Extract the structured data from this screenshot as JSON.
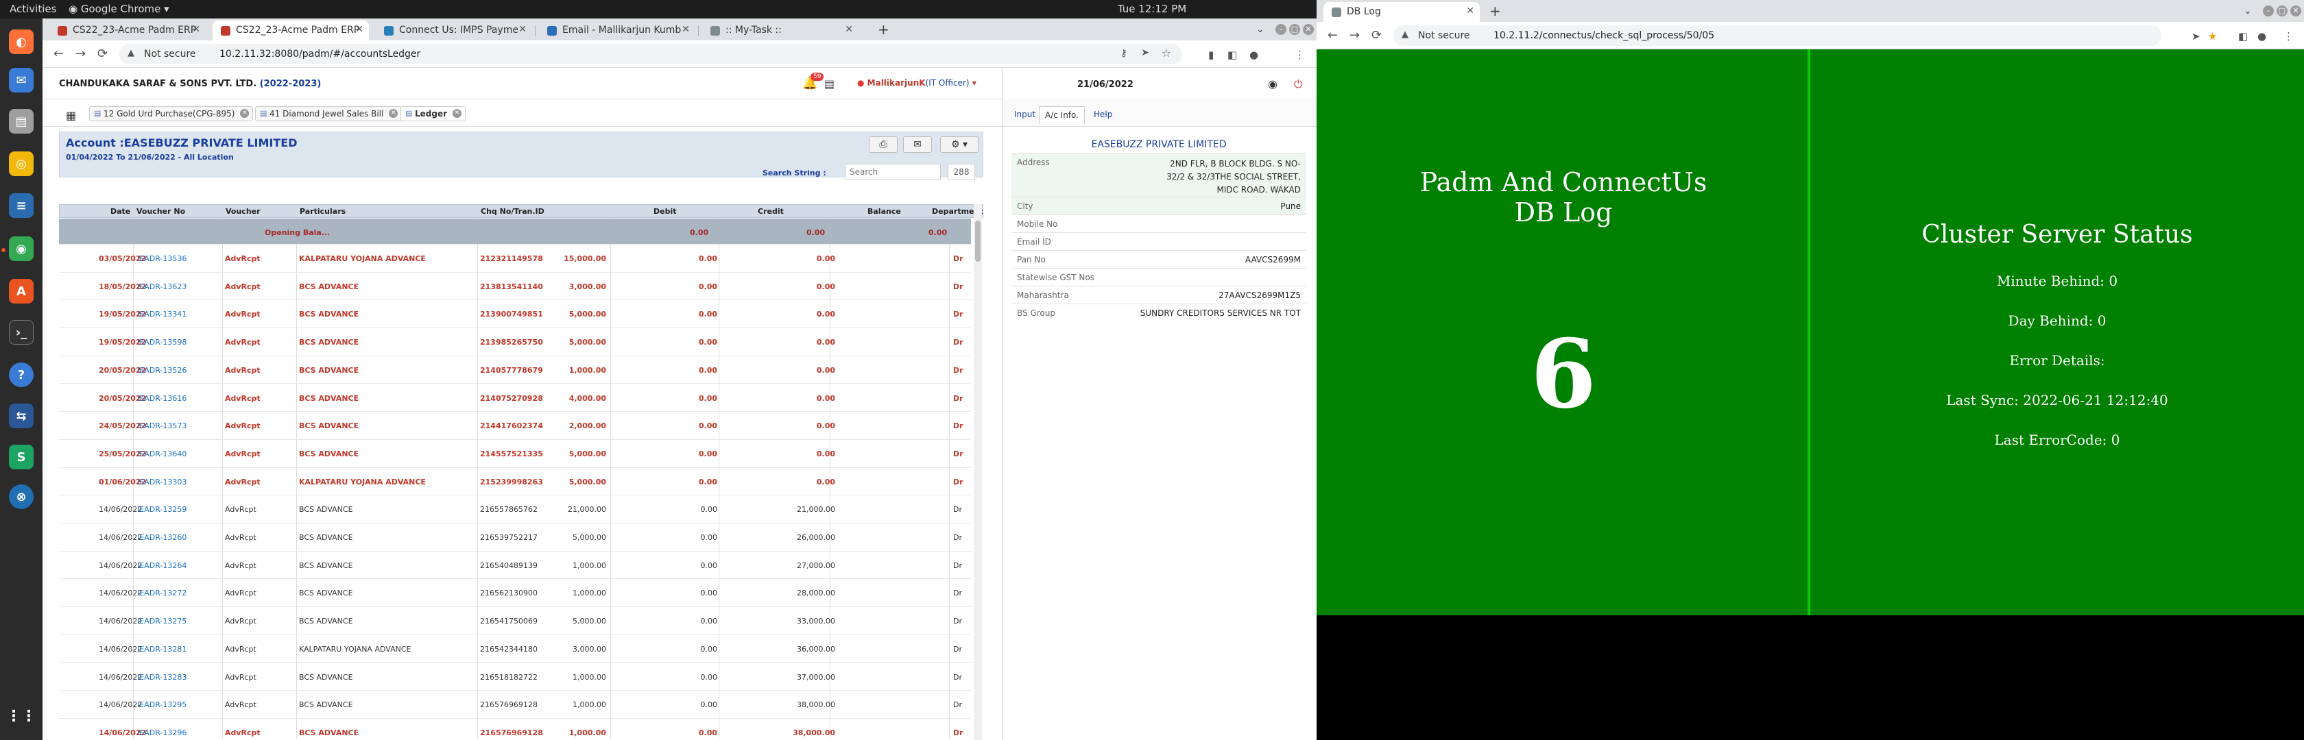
{
  "topbar": {
    "activities": "Activities",
    "app": "Google Chrome ▾",
    "clock": "Tue 12:12 PM"
  },
  "dock": {
    "icons": [
      "firefox-icon",
      "thunderbird-icon",
      "files-icon",
      "rhythmbox-icon",
      "writer-icon",
      "chrome-icon",
      "software-icon",
      "terminal-icon",
      "help-icon",
      "remmina-icon",
      "sheets-icon",
      "network-icon",
      "app-grid-icon"
    ]
  },
  "win1": {
    "tabs": [
      {
        "label": "CS22_23-Acme Padm ERP",
        "color": "#c0392b"
      },
      {
        "label": "CS22_23-Acme Padm ERP",
        "color": "#c0392b"
      },
      {
        "label": "Connect Us: IMPS Payme",
        "color": "#2980b9"
      },
      {
        "label": "Email - Mallikarjun Kumb",
        "color": "#2c6fbb"
      },
      {
        "label": ":: My-Task ::",
        "color": "#7f8c8d"
      }
    ],
    "url": "10.2.11.32:8080/padm/#/accountsLedger",
    "not_secure": "Not secure"
  },
  "app": {
    "company": "CHANDUKAKA SARAF & SONS PVT. LTD.",
    "year": "(2022-2023)",
    "badge": "59",
    "user": "MallikarjunK",
    "role": "(IT Officer)",
    "date": "21/06/2022",
    "page_tabs": [
      "12 Gold Urd Purchase(CPG-895)",
      "41 Diamond Jewel Sales Bill",
      "Ledger"
    ],
    "account": "Account :EASEBUZZ PRIVATE LIMITED",
    "period": "01/04/2022 To 21/06/2022 - All Location",
    "search_label": "Search String :",
    "search_placeholder": "Search",
    "search_count": "288",
    "columns": [
      "Date",
      "Voucher No",
      "Voucher",
      "Particulars",
      "Chq No/Tran.ID",
      "Debit",
      "Credit",
      "Balance",
      "Department"
    ],
    "opening": {
      "voucher": "Opening Bala...",
      "debit": "0.00",
      "credit": "0.00",
      "balance": "0.00"
    },
    "rows": [
      {
        "date": "03/05/2022",
        "vno": "IEADR-13536",
        "voucher": "AdvRcpt",
        "part": "KALPATARU YOJANA ADVANCE",
        "chq": "212321149578",
        "debit": "15,000.00",
        "credit": "0.00",
        "bal": "0.00",
        "drcr": "Dr",
        "red": true
      },
      {
        "date": "18/05/2022",
        "vno": "IEADR-13623",
        "voucher": "AdvRcpt",
        "part": "BCS ADVANCE",
        "chq": "213813541140",
        "debit": "3,000.00",
        "credit": "0.00",
        "bal": "0.00",
        "drcr": "Dr",
        "red": true
      },
      {
        "date": "19/05/2022",
        "vno": "IEADR-13341",
        "voucher": "AdvRcpt",
        "part": "BCS ADVANCE",
        "chq": "213900749851",
        "debit": "5,000.00",
        "credit": "0.00",
        "bal": "0.00",
        "drcr": "Dr",
        "red": true
      },
      {
        "date": "19/05/2022",
        "vno": "IEADR-13598",
        "voucher": "AdvRcpt",
        "part": "BCS ADVANCE",
        "chq": "213985265750",
        "debit": "5,000.00",
        "credit": "0.00",
        "bal": "0.00",
        "drcr": "Dr",
        "red": true
      },
      {
        "date": "20/05/2022",
        "vno": "IEADR-13526",
        "voucher": "AdvRcpt",
        "part": "BCS ADVANCE",
        "chq": "214057778679",
        "debit": "1,000.00",
        "credit": "0.00",
        "bal": "0.00",
        "drcr": "Dr",
        "red": true
      },
      {
        "date": "20/05/2022",
        "vno": "IEADR-13616",
        "voucher": "AdvRcpt",
        "part": "BCS ADVANCE",
        "chq": "214075270928",
        "debit": "4,000.00",
        "credit": "0.00",
        "bal": "0.00",
        "drcr": "Dr",
        "red": true
      },
      {
        "date": "24/05/2022",
        "vno": "IEADR-13573",
        "voucher": "AdvRcpt",
        "part": "BCS ADVANCE",
        "chq": "214417602374",
        "debit": "2,000.00",
        "credit": "0.00",
        "bal": "0.00",
        "drcr": "Dr",
        "red": true
      },
      {
        "date": "25/05/2022",
        "vno": "IEADR-13640",
        "voucher": "AdvRcpt",
        "part": "BCS ADVANCE",
        "chq": "214557521335",
        "debit": "5,000.00",
        "credit": "0.00",
        "bal": "0.00",
        "drcr": "Dr",
        "red": true
      },
      {
        "date": "01/06/2022",
        "vno": "IEADR-13303",
        "voucher": "AdvRcpt",
        "part": "KALPATARU YOJANA ADVANCE",
        "chq": "215239998263",
        "debit": "5,000.00",
        "credit": "0.00",
        "bal": "0.00",
        "drcr": "Dr",
        "red": true
      },
      {
        "date": "14/06/2022",
        "vno": "IEADR-13259",
        "voucher": "AdvRcpt",
        "part": "BCS ADVANCE",
        "chq": "216557865762",
        "debit": "21,000.00",
        "credit": "0.00",
        "bal": "21,000.00",
        "drcr": "Dr",
        "red": false
      },
      {
        "date": "14/06/2022",
        "vno": "IEADR-13260",
        "voucher": "AdvRcpt",
        "part": "BCS ADVANCE",
        "chq": "216539752217",
        "debit": "5,000.00",
        "credit": "0.00",
        "bal": "26,000.00",
        "drcr": "Dr",
        "red": false
      },
      {
        "date": "14/06/2022",
        "vno": "IEADR-13264",
        "voucher": "AdvRcpt",
        "part": "BCS ADVANCE",
        "chq": "216540489139",
        "debit": "1,000.00",
        "credit": "0.00",
        "bal": "27,000.00",
        "drcr": "Dr",
        "red": false
      },
      {
        "date": "14/06/2022",
        "vno": "IEADR-13272",
        "voucher": "AdvRcpt",
        "part": "BCS ADVANCE",
        "chq": "216562130900",
        "debit": "1,000.00",
        "credit": "0.00",
        "bal": "28,000.00",
        "drcr": "Dr",
        "red": false
      },
      {
        "date": "14/06/2022",
        "vno": "IEADR-13275",
        "voucher": "AdvRcpt",
        "part": "BCS ADVANCE",
        "chq": "216541750069",
        "debit": "5,000.00",
        "credit": "0.00",
        "bal": "33,000.00",
        "drcr": "Dr",
        "red": false
      },
      {
        "date": "14/06/2022",
        "vno": "IEADR-13281",
        "voucher": "AdvRcpt",
        "part": "KALPATARU YOJANA ADVANCE",
        "chq": "216542344180",
        "debit": "3,000.00",
        "credit": "0.00",
        "bal": "36,000.00",
        "drcr": "Dr",
        "red": false
      },
      {
        "date": "14/06/2022",
        "vno": "IEADR-13283",
        "voucher": "AdvRcpt",
        "part": "BCS ADVANCE",
        "chq": "216518182722",
        "debit": "1,000.00",
        "credit": "0.00",
        "bal": "37,000.00",
        "drcr": "Dr",
        "red": false
      },
      {
        "date": "14/06/2022",
        "vno": "IEADR-13295",
        "voucher": "AdvRcpt",
        "part": "BCS ADVANCE",
        "chq": "216576969128",
        "debit": "1,000.00",
        "credit": "0.00",
        "bal": "38,000.00",
        "drcr": "Dr",
        "red": false
      },
      {
        "date": "14/06/2022",
        "vno": "IEADR-13296",
        "voucher": "AdvRcpt",
        "part": "BCS ADVANCE",
        "chq": "216576969128",
        "debit": "1,000.00",
        "credit": "0.00",
        "bal": "38,000.00",
        "drcr": "Dr",
        "red": true
      }
    ],
    "right_tabs": [
      "Input",
      "A/c Info.",
      "Help"
    ],
    "info_name": "EASEBUZZ PRIVATE LIMITED",
    "info": [
      {
        "k": "Address",
        "v": "2ND FLR, B BLOCK BLDG. S NO- 32/2 & 32/3THE SOCIAL STREET, MIDC ROAD. WAKAD"
      },
      {
        "k": "City",
        "v": "Pune"
      },
      {
        "k": "Mobile No",
        "v": ""
      },
      {
        "k": "Email ID",
        "v": ""
      },
      {
        "k": "Pan No",
        "v": "AAVCS2699M"
      },
      {
        "k": "Statewise GST Nos",
        "v": ""
      },
      {
        "k": "Maharashtra",
        "v": "27AAVCS2699M1Z5"
      },
      {
        "k": "BS Group",
        "v": "SUNDRY CREDITORS SERVICES NR TOT"
      }
    ]
  },
  "win2": {
    "tab": "DB Log",
    "url": "10.2.11.2/connectus/check_sql_process/50/05",
    "not_secure": "Not secure",
    "left_title_1": "Padm And ConnectUs",
    "left_title_2": "DB Log",
    "number": "6",
    "right_title": "Cluster Server Status",
    "lines": [
      "Minute Behind: 0",
      "Day Behind: 0",
      "Error Details:",
      "Last Sync: 2022-06-21 12:12:40",
      "Last ErrorCode: 0"
    ]
  },
  "colors": {
    "accent_blue": "#1a3e9e",
    "red": "#c0392b",
    "green": "#008000"
  }
}
